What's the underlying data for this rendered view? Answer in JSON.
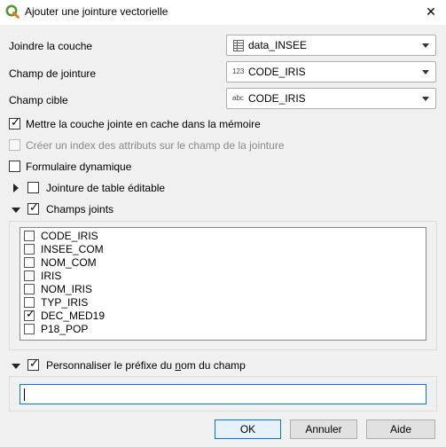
{
  "window": {
    "title": "Ajouter une jointure vectorielle",
    "close_glyph": "✕",
    "logo_icon": "qgis-logo-icon",
    "brand_color": "#589632"
  },
  "fields": {
    "join_layer": {
      "label": "Joindre la couche",
      "value": "data_INSEE",
      "icon": "table-icon"
    },
    "join_field": {
      "label": "Champ de jointure",
      "value": "CODE_IRIS",
      "icon_text": "123"
    },
    "target_field": {
      "label": "Champ cible",
      "value": "CODE_IRIS",
      "icon_text": "abc"
    }
  },
  "options": {
    "cache": {
      "label": "Mettre la couche jointe en cache dans la mémoire",
      "checked": true
    },
    "index": {
      "label": "Créer un index des attributs sur le champ de la jointure",
      "checked": false,
      "disabled": true
    },
    "dynamic_form": {
      "label": "Formulaire dynamique",
      "checked": false
    },
    "editable": {
      "label": "Jointure de table éditable",
      "checked": false,
      "expanded": false
    },
    "joined_fields": {
      "label_a": "Champs ",
      "label_u": "j",
      "label_b": "oints",
      "checked": true,
      "expanded": true
    },
    "prefix": {
      "label_a": "Personnaliser le préfixe du ",
      "label_u": "n",
      "label_b": "om du champ",
      "checked": true,
      "expanded": true
    }
  },
  "joined_fields_list": [
    {
      "name": "CODE_IRIS",
      "checked": false
    },
    {
      "name": "INSEE_COM",
      "checked": false
    },
    {
      "name": "NOM_COM",
      "checked": false
    },
    {
      "name": "IRIS",
      "checked": false
    },
    {
      "name": "NOM_IRIS",
      "checked": false
    },
    {
      "name": "TYP_IRIS",
      "checked": false
    },
    {
      "name": "DEC_MED19",
      "checked": true
    },
    {
      "name": "P18_POP",
      "checked": false
    }
  ],
  "prefix_input": {
    "value": ""
  },
  "buttons": {
    "ok": "OK",
    "cancel": "Annuler",
    "help": "Aide"
  },
  "check_glyph": "✓"
}
